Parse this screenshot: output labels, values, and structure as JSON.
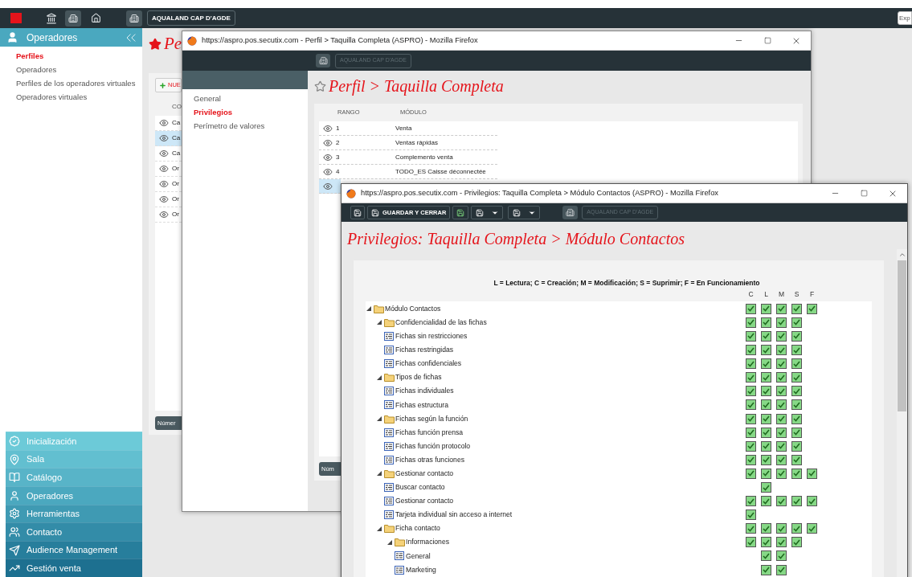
{
  "topbar": {
    "org_button": "AQUALAND CAP D'AGDE",
    "export_button": "Exp"
  },
  "sidebar": {
    "header": "Operadores",
    "items": [
      {
        "label": "Perfiles",
        "selected": true
      },
      {
        "label": "Operadores",
        "selected": false
      },
      {
        "label": "Perfiles de los operadores virtuales",
        "selected": false
      },
      {
        "label": "Operadores virtuales",
        "selected": false
      }
    ],
    "menu": [
      {
        "label": "Inicialización"
      },
      {
        "label": "Sala"
      },
      {
        "label": "Catálogo"
      },
      {
        "label": "Operadores"
      },
      {
        "label": "Herramientas"
      },
      {
        "label": "Contacto"
      },
      {
        "label": "Audience Management"
      },
      {
        "label": "Gestión venta"
      }
    ]
  },
  "main": {
    "title": "Pe",
    "new_button": "NUE",
    "column_header": "CO",
    "rows": [
      {
        "label": "Ca",
        "selected": false
      },
      {
        "label": "Ca",
        "selected": true
      },
      {
        "label": "Ca",
        "selected": false
      },
      {
        "label": "Or",
        "selected": false
      },
      {
        "label": "Or",
        "selected": false
      },
      {
        "label": "Or",
        "selected": false
      },
      {
        "label": "Or",
        "selected": false
      }
    ],
    "footer_button": "Númer"
  },
  "profile_window": {
    "title": "https://aspro.pos.secutix.com - Perfil > Taquilla Completa (ASPRO) - Mozilla Firefox",
    "org_button": "AQUALAND CAP D'AGDE",
    "nav": [
      {
        "label": "General",
        "selected": false
      },
      {
        "label": "Privilegios",
        "selected": true
      },
      {
        "label": "Perímetro de valores",
        "selected": false
      }
    ],
    "heading": "Perfil > Taquilla Completa",
    "columns": [
      "RANGO",
      "MÓDULO"
    ],
    "rows": [
      {
        "rango": "1",
        "modulo": "Venta",
        "selected": false
      },
      {
        "rango": "2",
        "modulo": "Ventas rápidas",
        "selected": false
      },
      {
        "rango": "3",
        "modulo": "Complemento venta",
        "selected": false
      },
      {
        "rango": "4",
        "modulo": "TODO_ES Caisse déconnectée",
        "selected": false
      },
      {
        "selected": true
      }
    ],
    "footer_button": "Núm"
  },
  "privileges_window": {
    "title": "https://aspro.pos.secutix.com - Privilegios: Taquilla Completa > Módulo Contactos (ASPRO) - Mozilla Firefox",
    "save_close_button": "GUARDAR Y CERRAR",
    "org_button": "AQUALAND CAP D'AGDE",
    "heading": "Privilegios: Taquilla Completa > Módulo Contactos",
    "legend": "L = Lectura; C = Creación; M = Modificación; S = Suprimir; F = En Funcionamiento",
    "columns": [
      "C",
      "L",
      "M",
      "S",
      "F"
    ],
    "tree": [
      {
        "label": "Módulo Contactos",
        "kind": "folder",
        "expanded": true,
        "boxes": [
          {
            "kind": "check",
            "checked": true
          },
          {
            "kind": "check",
            "checked": true
          },
          {
            "kind": "check",
            "checked": true
          },
          {
            "kind": "check",
            "checked": true
          },
          {
            "kind": "check",
            "checked": true
          }
        ],
        "children": [
          {
            "label": "Confidencialidad de las fichas",
            "kind": "folder",
            "expanded": true,
            "boxes": [
              {
                "kind": "check",
                "checked": true
              },
              {
                "kind": "check",
                "checked": true
              },
              {
                "kind": "check",
                "checked": true
              },
              {
                "kind": "check",
                "checked": true
              },
              {
                "kind": "blank"
              }
            ],
            "children": [
              {
                "label": "Fichas sin restricciones",
                "kind": "item",
                "boxes": [
                  {
                    "kind": "check",
                    "checked": true
                  },
                  {
                    "kind": "check",
                    "checked": true
                  },
                  {
                    "kind": "check",
                    "checked": true
                  },
                  {
                    "kind": "check",
                    "checked": true
                  },
                  {
                    "kind": "blank"
                  }
                ]
              },
              {
                "label": "Fichas restringidas",
                "kind": "item",
                "boxes": [
                  {
                    "kind": "check",
                    "checked": true
                  },
                  {
                    "kind": "check",
                    "checked": true
                  },
                  {
                    "kind": "check",
                    "checked": true
                  },
                  {
                    "kind": "check",
                    "checked": true
                  },
                  {
                    "kind": "blank"
                  }
                ]
              },
              {
                "label": "Fichas confidenciales",
                "kind": "item",
                "boxes": [
                  {
                    "kind": "check",
                    "checked": true
                  },
                  {
                    "kind": "check",
                    "checked": true
                  },
                  {
                    "kind": "check",
                    "checked": true
                  },
                  {
                    "kind": "check",
                    "checked": true
                  },
                  {
                    "kind": "blank"
                  }
                ]
              }
            ]
          },
          {
            "label": "Tipos de fichas",
            "kind": "folder",
            "expanded": true,
            "boxes": [
              {
                "kind": "check",
                "checked": true
              },
              {
                "kind": "check",
                "checked": true
              },
              {
                "kind": "check",
                "checked": true
              },
              {
                "kind": "check",
                "checked": true
              },
              {
                "kind": "blank"
              }
            ],
            "children": [
              {
                "label": "Fichas individuales",
                "kind": "item",
                "boxes": [
                  {
                    "kind": "check",
                    "checked": true
                  },
                  {
                    "kind": "check",
                    "checked": true
                  },
                  {
                    "kind": "check",
                    "checked": true
                  },
                  {
                    "kind": "check",
                    "checked": true
                  },
                  {
                    "kind": "blank"
                  }
                ]
              },
              {
                "label": "Fichas estructura",
                "kind": "item",
                "boxes": [
                  {
                    "kind": "check",
                    "checked": true
                  },
                  {
                    "kind": "check",
                    "checked": true
                  },
                  {
                    "kind": "check",
                    "checked": true
                  },
                  {
                    "kind": "check",
                    "checked": true
                  },
                  {
                    "kind": "blank"
                  }
                ]
              }
            ]
          },
          {
            "label": "Fichas según la función",
            "kind": "folder",
            "expanded": true,
            "boxes": [
              {
                "kind": "check",
                "checked": true
              },
              {
                "kind": "check",
                "checked": true
              },
              {
                "kind": "check",
                "checked": true
              },
              {
                "kind": "check",
                "checked": true
              },
              {
                "kind": "blank"
              }
            ],
            "children": [
              {
                "label": "Fichas función prensa",
                "kind": "item",
                "boxes": [
                  {
                    "kind": "check",
                    "checked": true
                  },
                  {
                    "kind": "check",
                    "checked": true
                  },
                  {
                    "kind": "check",
                    "checked": true
                  },
                  {
                    "kind": "check",
                    "checked": true
                  },
                  {
                    "kind": "blank"
                  }
                ]
              },
              {
                "label": "Fichas función protocolo",
                "kind": "item",
                "boxes": [
                  {
                    "kind": "check",
                    "checked": true
                  },
                  {
                    "kind": "check",
                    "checked": true
                  },
                  {
                    "kind": "check",
                    "checked": true
                  },
                  {
                    "kind": "check",
                    "checked": true
                  },
                  {
                    "kind": "blank"
                  }
                ]
              },
              {
                "label": "Fichas otras funciones",
                "kind": "item",
                "boxes": [
                  {
                    "kind": "check",
                    "checked": true
                  },
                  {
                    "kind": "check",
                    "checked": true
                  },
                  {
                    "kind": "check",
                    "checked": true
                  },
                  {
                    "kind": "check",
                    "checked": true
                  },
                  {
                    "kind": "blank"
                  }
                ]
              }
            ]
          },
          {
            "label": "Gestionar contacto",
            "kind": "folder",
            "expanded": true,
            "boxes": [
              {
                "kind": "check",
                "checked": true
              },
              {
                "kind": "check",
                "checked": true
              },
              {
                "kind": "check",
                "checked": true
              },
              {
                "kind": "check",
                "checked": true
              },
              {
                "kind": "check",
                "checked": true
              }
            ],
            "children": [
              {
                "label": "Buscar contacto",
                "kind": "item",
                "boxes": [
                  {
                    "kind": "blank"
                  },
                  {
                    "kind": "check",
                    "checked": true
                  },
                  {
                    "kind": "blank"
                  },
                  {
                    "kind": "blank"
                  },
                  {
                    "kind": "blank"
                  }
                ]
              },
              {
                "label": "Gestionar contacto",
                "kind": "item",
                "boxes": [
                  {
                    "kind": "check",
                    "checked": true
                  },
                  {
                    "kind": "check",
                    "checked": true
                  },
                  {
                    "kind": "check",
                    "checked": true
                  },
                  {
                    "kind": "check",
                    "checked": true
                  },
                  {
                    "kind": "check",
                    "checked": true
                  }
                ]
              },
              {
                "label": "Tarjeta individual sin acceso a internet",
                "kind": "item",
                "boxes": [
                  {
                    "kind": "check",
                    "checked": true
                  },
                  {
                    "kind": "blank"
                  },
                  {
                    "kind": "blank"
                  },
                  {
                    "kind": "blank"
                  },
                  {
                    "kind": "blank"
                  }
                ]
              }
            ]
          },
          {
            "label": "Ficha contacto",
            "kind": "folder",
            "expanded": true,
            "boxes": [
              {
                "kind": "check",
                "checked": true
              },
              {
                "kind": "check",
                "checked": true
              },
              {
                "kind": "check",
                "checked": true
              },
              {
                "kind": "check",
                "checked": true
              },
              {
                "kind": "check",
                "checked": true
              }
            ],
            "children": [
              {
                "label": "Informaciones",
                "kind": "folder",
                "expanded": true,
                "boxes": [
                  {
                    "kind": "check",
                    "checked": true
                  },
                  {
                    "kind": "check",
                    "checked": true
                  },
                  {
                    "kind": "check",
                    "checked": true
                  },
                  {
                    "kind": "check",
                    "checked": true
                  },
                  {
                    "kind": "blank"
                  }
                ],
                "children": [
                  {
                    "label": "General",
                    "kind": "item",
                    "boxes": [
                      {
                        "kind": "blank"
                      },
                      {
                        "kind": "check",
                        "checked": true
                      },
                      {
                        "kind": "check",
                        "checked": true
                      },
                      {
                        "kind": "blank"
                      },
                      {
                        "kind": "blank"
                      }
                    ]
                  },
                  {
                    "label": "Marketing",
                    "kind": "item",
                    "boxes": [
                      {
                        "kind": "blank"
                      },
                      {
                        "kind": "check",
                        "checked": true
                      },
                      {
                        "kind": "check",
                        "checked": true
                      },
                      {
                        "kind": "blank"
                      },
                      {
                        "kind": "blank"
                      }
                    ]
                  }
                ]
              }
            ]
          }
        ]
      }
    ]
  }
}
